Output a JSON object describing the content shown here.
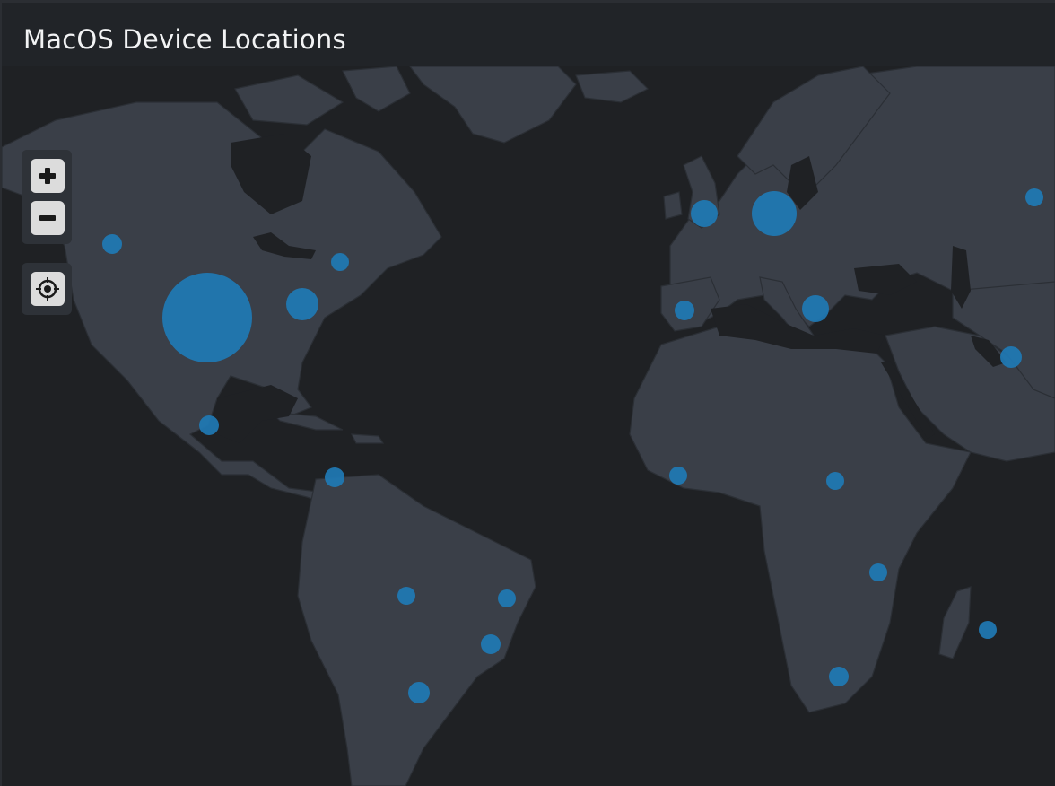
{
  "panel": {
    "title": "MacOS Device Locations"
  },
  "map_controls": {
    "zoom_in_icon": "plus-icon",
    "zoom_out_icon": "minus-icon",
    "locate_icon": "crosshair-icon"
  },
  "colors": {
    "background": "#1f2124",
    "land": "#3a3f48",
    "borders": "#2b2f35",
    "marker": "#1f7ab5",
    "header": "#212428",
    "title_text": "#f2f3f4"
  },
  "markers": [
    {
      "id": "usa-central",
      "lat": 39.0,
      "lon": -98.0,
      "size": "largest"
    },
    {
      "id": "usa-northwest",
      "lat": 47.6,
      "lon": -122.3,
      "size": "small"
    },
    {
      "id": "usa-east",
      "lat": 38.9,
      "lon": -80.0,
      "size": "medium"
    },
    {
      "id": "usa-northeast",
      "lat": 43.0,
      "lon": -76.0,
      "size": "small"
    },
    {
      "id": "mexico",
      "lat": 19.4,
      "lon": -99.1,
      "size": "small"
    },
    {
      "id": "colombia",
      "lat": 10.4,
      "lon": -75.5,
      "size": "small"
    },
    {
      "id": "brazil-west",
      "lat": -15.6,
      "lon": -56.1,
      "size": "small"
    },
    {
      "id": "brazil-east",
      "lat": -12.9,
      "lon": -38.5,
      "size": "small"
    },
    {
      "id": "brazil-south",
      "lat": -22.9,
      "lon": -43.2,
      "size": "small"
    },
    {
      "id": "uruguay",
      "lat": -34.9,
      "lon": -56.2,
      "size": "small"
    },
    {
      "id": "uk",
      "lat": 51.5,
      "lon": -0.1,
      "size": "medium"
    },
    {
      "id": "germany",
      "lat": 52.0,
      "lon": 13.0,
      "size": "large"
    },
    {
      "id": "spain",
      "lat": 40.4,
      "lon": -3.7,
      "size": "small"
    },
    {
      "id": "greece",
      "lat": 38.0,
      "lon": 23.7,
      "size": "medium"
    },
    {
      "id": "russia",
      "lat": 55.7,
      "lon": 37.6,
      "size": "small"
    },
    {
      "id": "gulf",
      "lat": 25.2,
      "lon": 55.3,
      "size": "small"
    },
    {
      "id": "west-africa",
      "lat": 6.5,
      "lon": -2.0,
      "size": "small"
    },
    {
      "id": "central-africa",
      "lat": 6.0,
      "lon": 25.0,
      "size": "small"
    },
    {
      "id": "east-africa",
      "lat": -6.8,
      "lon": 34.5,
      "size": "small"
    },
    {
      "id": "south-africa",
      "lat": -26.2,
      "lon": 28.0,
      "size": "small"
    },
    {
      "id": "mauritius",
      "lat": -20.2,
      "lon": 57.5,
      "size": "small"
    }
  ]
}
